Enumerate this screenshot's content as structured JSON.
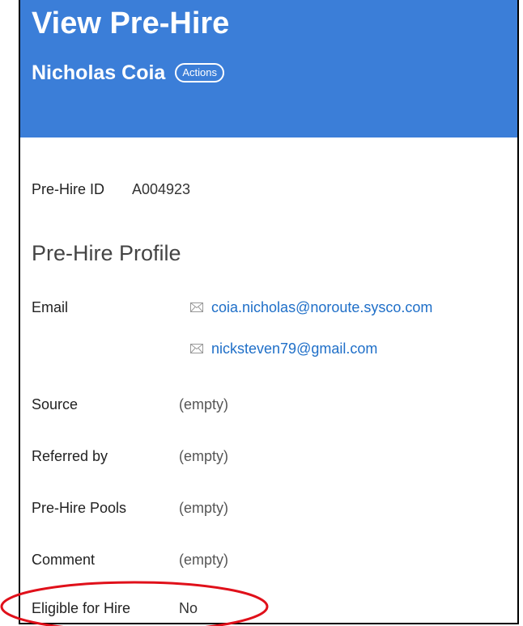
{
  "header": {
    "title": "View Pre-Hire",
    "name": "Nicholas Coia",
    "actions_label": "Actions"
  },
  "prehire_id": {
    "label": "Pre-Hire ID",
    "value": "A004923"
  },
  "profile": {
    "section_title": "Pre-Hire Profile",
    "email_label": "Email",
    "emails": [
      "coia.nicholas@noroute.sysco.com",
      "nicksteven79@gmail.com"
    ],
    "source": {
      "label": "Source",
      "value": "(empty)"
    },
    "referred_by": {
      "label": "Referred by",
      "value": "(empty)"
    },
    "pools": {
      "label": "Pre-Hire Pools",
      "value": "(empty)"
    },
    "comment": {
      "label": "Comment",
      "value": "(empty)"
    },
    "eligible": {
      "label": "Eligible for Hire",
      "value": "No"
    }
  },
  "colors": {
    "header_bg": "#3b7ed8",
    "link": "#1f6fc8",
    "highlight": "#e0101a"
  },
  "icons": {
    "email": "envelope-icon"
  }
}
